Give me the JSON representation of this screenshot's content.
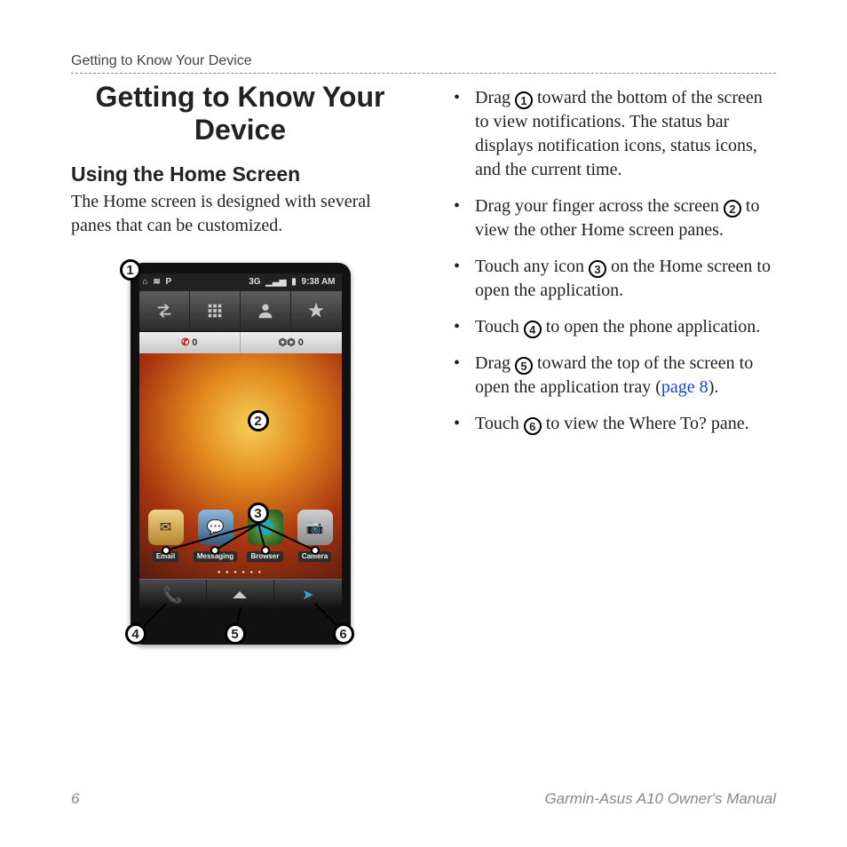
{
  "header": "Getting to Know Your Device",
  "title": "Getting to Know Your Device",
  "subtitle": "Using the Home Screen",
  "intro": "The Home screen is designed with several panes that can be customized.",
  "phone": {
    "status_time": "9:38 AM",
    "status_net": "3G",
    "sub_left_count": "0",
    "sub_right_count": "0",
    "apps": [
      "Email",
      "Messaging",
      "Browser",
      "Camera"
    ]
  },
  "callouts": [
    "1",
    "2",
    "3",
    "4",
    "5",
    "6"
  ],
  "bullets": [
    {
      "pre": "Drag ",
      "num": "1",
      "post": " toward the bottom of the screen to view notifications. The status bar displays notification icons, status icons, and the current time."
    },
    {
      "pre": "Drag your finger across the screen ",
      "num": "2",
      "post": " to view the other Home screen panes."
    },
    {
      "pre": "Touch any icon ",
      "num": "3",
      "post": " on the Home screen to open the application."
    },
    {
      "pre": "Touch ",
      "num": "4",
      "post": " to open the phone application."
    },
    {
      "pre": "Drag ",
      "num": "5",
      "post": " toward the top of the screen to open the application tray (",
      "link": "page 8",
      "post2": ")."
    },
    {
      "pre": "Touch ",
      "num": "6",
      "post": " to view the Where To? pane."
    }
  ],
  "footer_page": "6",
  "footer_title": "Garmin-Asus A10 Owner's Manual"
}
